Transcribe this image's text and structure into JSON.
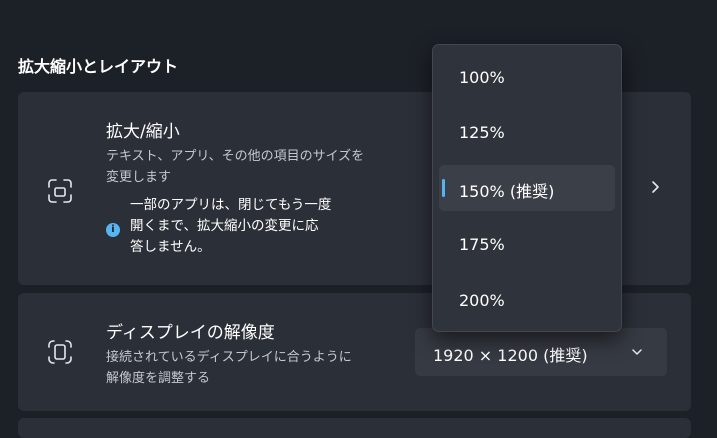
{
  "section": {
    "title": "拡大縮小とレイアウト"
  },
  "scale": {
    "title": "拡大/縮小",
    "description_line1": "テキスト、アプリ、その他の項目のサイズを",
    "description_line2": "変更します",
    "info_line1": "一部のアプリは、閉じてもう一度",
    "info_line2": "開くまで、拡大縮小の変更に応",
    "info_line3": "答しません。",
    "info_icon_glyph": "i",
    "icon": "scale-icon",
    "chevron_icon": "chevron-right-icon"
  },
  "resolution": {
    "title": "ディスプレイの解像度",
    "description_line1": "接続されているディスプレイに合うように",
    "description_line2": "解像度を調整する",
    "selected_value": "1920 × 1200 (推奨)",
    "icon": "resolution-icon",
    "chevron_icon": "chevron-down-icon"
  },
  "dropdown": {
    "selected_index": 2,
    "options": [
      {
        "label": "100%"
      },
      {
        "label": "125%"
      },
      {
        "label": "150% (推奨)"
      },
      {
        "label": "175%"
      },
      {
        "label": "200%"
      }
    ]
  },
  "colors": {
    "background": "#1c2027",
    "card": "#2b2f37",
    "accent": "#57b3f2",
    "dropdown": "#2f333b"
  }
}
